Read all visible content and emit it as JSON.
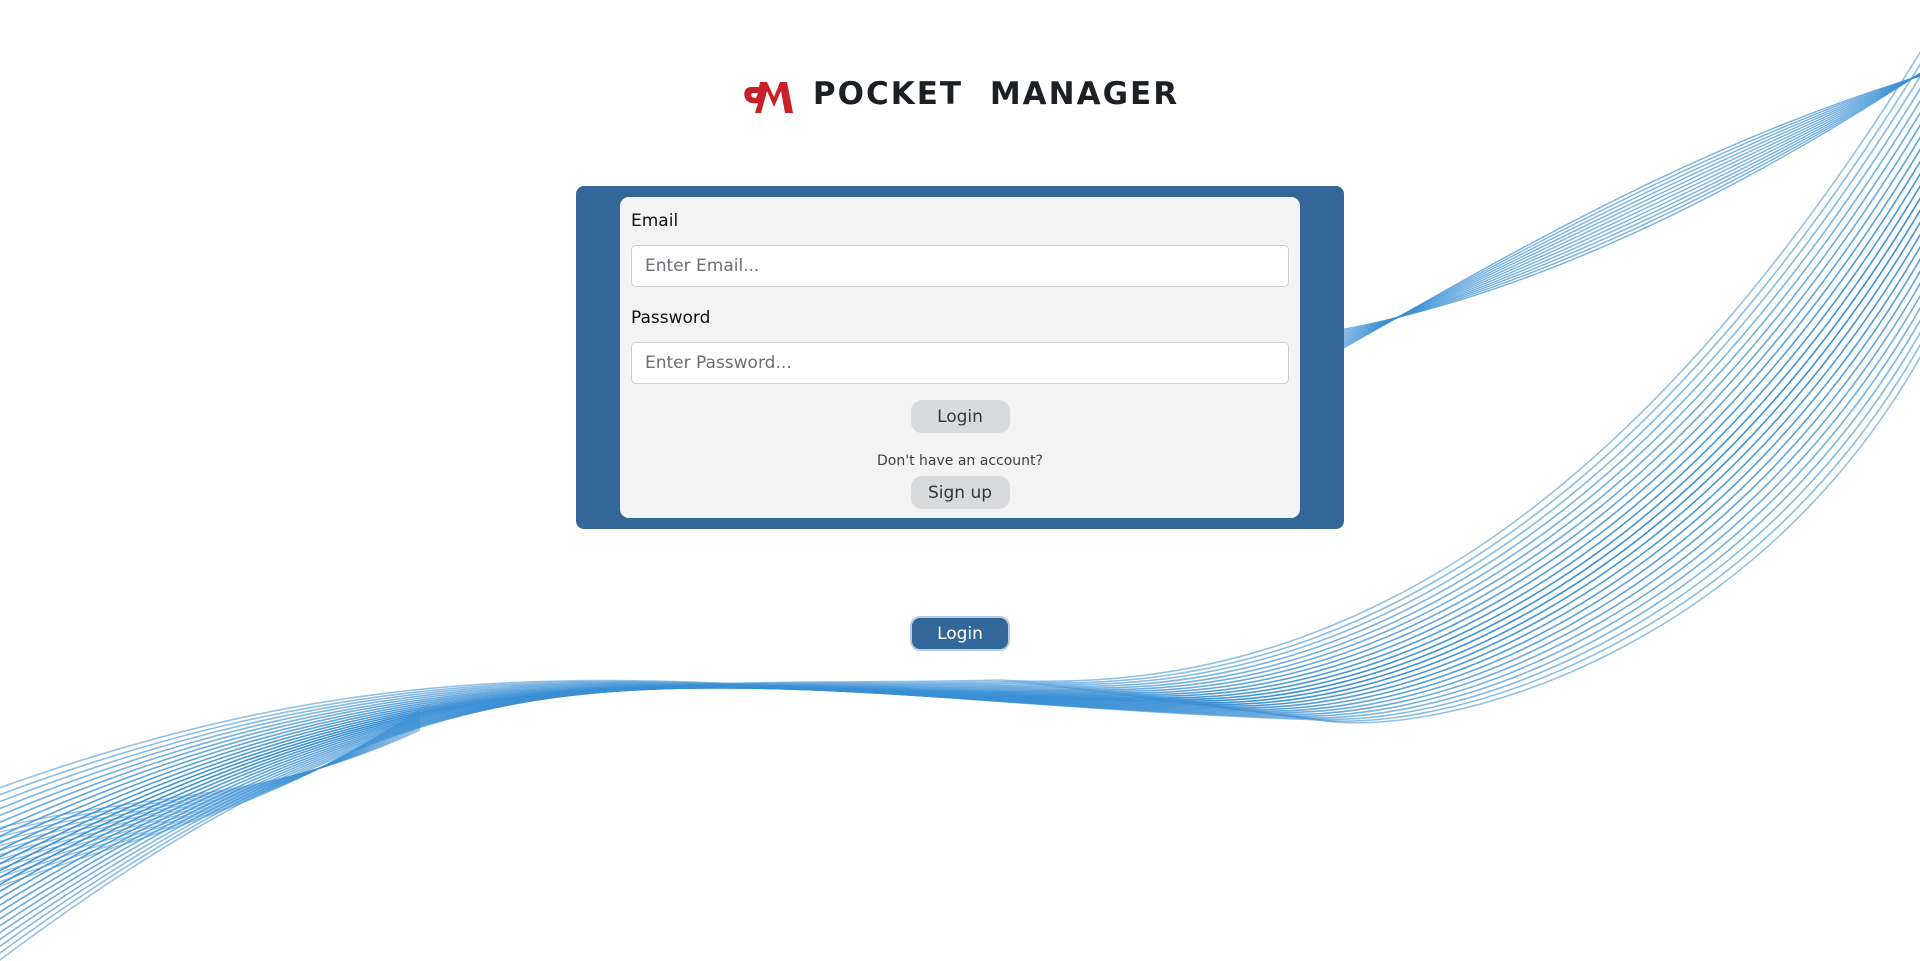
{
  "brand": {
    "title": "POCKET MANAGER",
    "logo_icon": "pm-logo-icon",
    "logo_color": "#c8202a"
  },
  "theme": {
    "primary": "#336699",
    "wave_color": "#3a8fd4",
    "card_bg": "#f3f3f3"
  },
  "login_form": {
    "email_label": "Email",
    "email_placeholder": "Enter Email...",
    "email_value": "",
    "password_label": "Password",
    "password_placeholder": "Enter Password...",
    "password_value": "",
    "login_button_label": "Login",
    "signup_prompt": "Don't have an account?",
    "signup_button_label": "Sign up"
  },
  "mode_toggle": {
    "label": "Login"
  }
}
